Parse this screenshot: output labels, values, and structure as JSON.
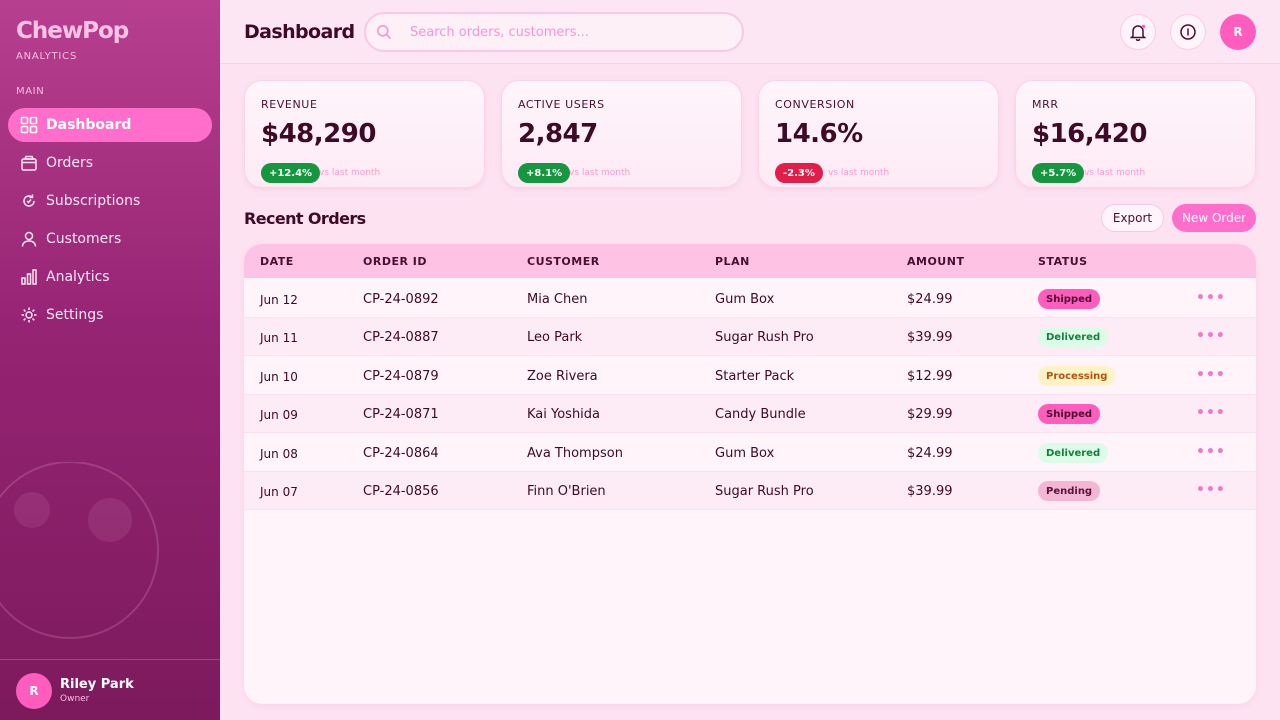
{
  "brand": {
    "name": "ChewPop",
    "subtitle": "ANALYTICS"
  },
  "sidebar": {
    "section_label": "MAIN",
    "items": [
      {
        "label": "Dashboard",
        "icon": "grid-icon",
        "active": true
      },
      {
        "label": "Orders",
        "icon": "box-icon",
        "active": false
      },
      {
        "label": "Subscriptions",
        "icon": "refresh-icon",
        "active": false
      },
      {
        "label": "Customers",
        "icon": "user-icon",
        "active": false
      },
      {
        "label": "Analytics",
        "icon": "bar-chart-icon",
        "active": false
      },
      {
        "label": "Settings",
        "icon": "gear-icon",
        "active": false
      }
    ],
    "user": {
      "initial": "R",
      "name": "Riley Park",
      "role": "Owner"
    }
  },
  "header": {
    "title": "Dashboard",
    "search_placeholder": "Search orders, customers...",
    "avatar_initial": "R"
  },
  "stats": [
    {
      "label": "REVENUE",
      "value": "$48,290",
      "delta": "+12.4%",
      "direction": "up",
      "note": "vs last month"
    },
    {
      "label": "ACTIVE USERS",
      "value": "2,847",
      "delta": "+8.1%",
      "direction": "up",
      "note": "vs last month"
    },
    {
      "label": "CONVERSION",
      "value": "14.6%",
      "delta": "-2.3%",
      "direction": "down",
      "note": "vs last month"
    },
    {
      "label": "MRR",
      "value": "$16,420",
      "delta": "+5.7%",
      "direction": "up",
      "note": "vs last month"
    }
  ],
  "orders": {
    "title": "Recent Orders",
    "export_label": "Export",
    "new_label": "New Order",
    "columns": [
      "DATE",
      "ORDER ID",
      "CUSTOMER",
      "PLAN",
      "AMOUNT",
      "STATUS"
    ],
    "rows": [
      {
        "date": "Jun 12",
        "id": "CP-24-0892",
        "customer": "Mia Chen",
        "plan": "Gum Box",
        "amount": "$24.99",
        "status": "Shipped"
      },
      {
        "date": "Jun 11",
        "id": "CP-24-0887",
        "customer": "Leo Park",
        "plan": "Sugar Rush Pro",
        "amount": "$39.99",
        "status": "Delivered"
      },
      {
        "date": "Jun 10",
        "id": "CP-24-0879",
        "customer": "Zoe Rivera",
        "plan": "Starter Pack",
        "amount": "$12.99",
        "status": "Processing"
      },
      {
        "date": "Jun 09",
        "id": "CP-24-0871",
        "customer": "Kai Yoshida",
        "plan": "Candy Bundle",
        "amount": "$29.99",
        "status": "Shipped"
      },
      {
        "date": "Jun 08",
        "id": "CP-24-0864",
        "customer": "Ava Thompson",
        "plan": "Gum Box",
        "amount": "$24.99",
        "status": "Delivered"
      },
      {
        "date": "Jun 07",
        "id": "CP-24-0856",
        "customer": "Finn O'Brien",
        "plan": "Sugar Rush Pro",
        "amount": "$39.99",
        "status": "Pending"
      }
    ],
    "more_glyph": "•••"
  },
  "colors": {
    "accent": "#ff6ecb",
    "sidebar_top": "#b83f8f",
    "sidebar_bottom": "#7c1a5c",
    "positive": "#15963f",
    "negative": "#e11d48"
  }
}
